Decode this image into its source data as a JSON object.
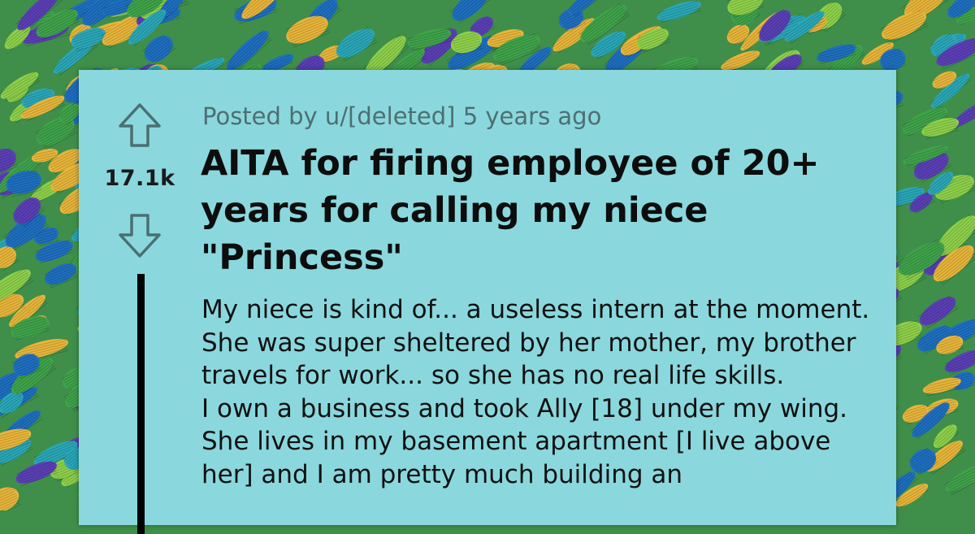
{
  "post": {
    "posted_by": "Posted by u/[deleted] 5 years ago",
    "title": "AITA for firing employee of 20+ years for calling my niece \"Princess\"",
    "body_paragraphs": [
      "My niece is kind of... a useless intern at the moment. She was super sheltered by her mother, my brother travels for work... so she has no real life skills.",
      "I own a business and took Ally [18] under my wing. She lives in my basement apartment [I live above her] and I am pretty much building an"
    ]
  },
  "votes": {
    "count": "17.1k",
    "upvote_icon": "upvote-arrow-icon",
    "downvote_icon": "downvote-arrow-icon"
  },
  "colors": {
    "card_background": "#8ad8dd",
    "background_scribble_colors": [
      "#2aa7b8",
      "#e8b53a",
      "#5b3fb6",
      "#3fa34a",
      "#1e6fc0",
      "#8ed04a"
    ]
  }
}
